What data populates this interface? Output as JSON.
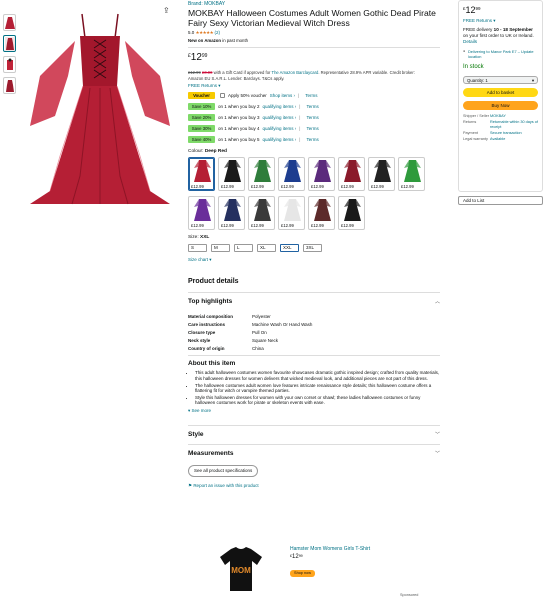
{
  "product": {
    "brand": "Brand: MOKBAY",
    "title": "MOKBAY Halloween Costumes Adult Women Gothic Dead Pirate Fairy Sexy Victorian Medieval Witch Dress",
    "rating_value": "5.0",
    "stars": "★★★★★",
    "review_count": "(2)",
    "new_label": "New on Amazon",
    "new_suffix": "in past month",
    "price_currency": "£",
    "price_whole": "12",
    "price_fraction": "99",
    "pricebar_old": "£12.99",
    "pricebar_credit": "£0.00",
    "pricebar_text": "with a Gift Card if approved for",
    "pricebar_link": "The Amazon Barclaycard",
    "pricebar_tail": ". Representative 28.9% APR variable.",
    "pricebar_credit_broker": "Credit broker:",
    "pricebar_line2": "Amazon EU S.A.R.L. Lender: Barclays. T&Cs apply.",
    "returns": "FREE Returns ▾"
  },
  "offers": [
    {
      "badge": "Voucher",
      "kind": "voucher",
      "text": "Apply 50% voucher",
      "link": "Shop items ›",
      "terms": "Terms"
    },
    {
      "badge": "Save 10%",
      "kind": "save",
      "text": "on 1 when you buy 2",
      "link": "qualifying items ›",
      "terms": "Terms"
    },
    {
      "badge": "Save 20%",
      "kind": "save",
      "text": "on 1 when you buy 3",
      "link": "qualifying items ›",
      "terms": "Terms"
    },
    {
      "badge": "Save 30%",
      "kind": "save",
      "text": "on 1 when you buy 4",
      "link": "qualifying items ›",
      "terms": "Terms"
    },
    {
      "badge": "Save 40%",
      "kind": "save",
      "text": "on 1 when you buy 5",
      "link": "qualifying items ›",
      "terms": "Terms"
    }
  ],
  "colour": {
    "label": "Colour:",
    "value": "Deep Red"
  },
  "swatches": [
    {
      "price": "£12.99",
      "color": "#b51f35",
      "selected": true
    },
    {
      "price": "£12.99",
      "color": "#1b1b1b"
    },
    {
      "price": "£12.99",
      "color": "#2f7d3b"
    },
    {
      "price": "£12.99",
      "color": "#1d3d8f"
    },
    {
      "price": "£12.99",
      "color": "#5b2a7c"
    },
    {
      "price": "£12.99",
      "color": "#8a1a2a"
    },
    {
      "price": "£12.99",
      "color": "#222222"
    },
    {
      "price": "£12.99",
      "color": "#2e9a3c"
    },
    {
      "price": "£12.99",
      "color": "#6a2e9a"
    },
    {
      "price": "£12.99",
      "color": "#25305f"
    },
    {
      "price": "£12.99",
      "color": "#3a3a3a"
    },
    {
      "price": "£12.99",
      "color": "#e6e6e6"
    },
    {
      "price": "£12.99",
      "color": "#5c2a2a"
    },
    {
      "price": "£12.99",
      "color": "#1a1a1a"
    }
  ],
  "size": {
    "label": "Size:",
    "value": "XXL",
    "options": [
      "S",
      "M",
      "L",
      "XL",
      "XXL",
      "3XL"
    ],
    "selected_index": 4
  },
  "size_chart": "Size chart ▾",
  "buybox": {
    "currency": "£",
    "whole": "12",
    "fraction": "99",
    "returns": "FREE Returns ▾",
    "delivery_prefix": "FREE delivery",
    "delivery_date": "10 - 18 September",
    "delivery_suffix": "on your first order to UK or Ireland.",
    "details": "Details",
    "location": "Delivering to Manor Park E7 – Update location",
    "stock": "In stock",
    "quantity": "Quantity: 1",
    "add_to_basket": "Add to basket",
    "buy_now": "Buy Now",
    "info": [
      {
        "k": "Shipper / Seller",
        "v": "MOKBAY"
      },
      {
        "k": "Returns",
        "v": "Returnable within 30 days of receipt"
      },
      {
        "k": "Payment",
        "v": "Secure transaction"
      },
      {
        "k": "Legal warranty",
        "v": "Available"
      }
    ],
    "add_to_list": "Add to List"
  },
  "details": {
    "heading": "Product details",
    "top_highlights": "Top highlights",
    "specs": [
      {
        "k": "Material composition",
        "v": "Polyester"
      },
      {
        "k": "Care instructions",
        "v": "Machine Wash Or Hand Wash"
      },
      {
        "k": "Closure type",
        "v": "Pull On"
      },
      {
        "k": "Neck style",
        "v": "Square Neck"
      },
      {
        "k": "Country of origin",
        "v": "China"
      }
    ],
    "about_heading": "About this item",
    "about": [
      "This adult halloween costumes women favourite showcases dramatic gothic inspired design; crafted from quality materials, this halloween dresses for women delivers that wicked medieval look, and additional pieces are not part of this dress.",
      "The halloween costumes adult women love features intricate renaissance style details; this halloween costume offers a flattering fit for witch or vampire themed parties.",
      "Style this halloween dresses for women with your own corset or shawl; these ladies halloween costumes or funny halloween costumes work for pirate or skeleton events with ease."
    ],
    "see_more": "See more",
    "style": "Style",
    "measurements": "Measurements",
    "see_all": "See all product specifications",
    "report": "Report an issue with this product"
  },
  "ad": {
    "title": "Hamster Mom Womens Girls T-Shirt",
    "currency": "£",
    "whole": "12",
    "fraction": "99",
    "button": "Shop now",
    "shirt_text": "MOM",
    "sponsored": "Sponsored"
  },
  "icons": {
    "share": "share-icon",
    "chevron": "chevron-icon"
  }
}
